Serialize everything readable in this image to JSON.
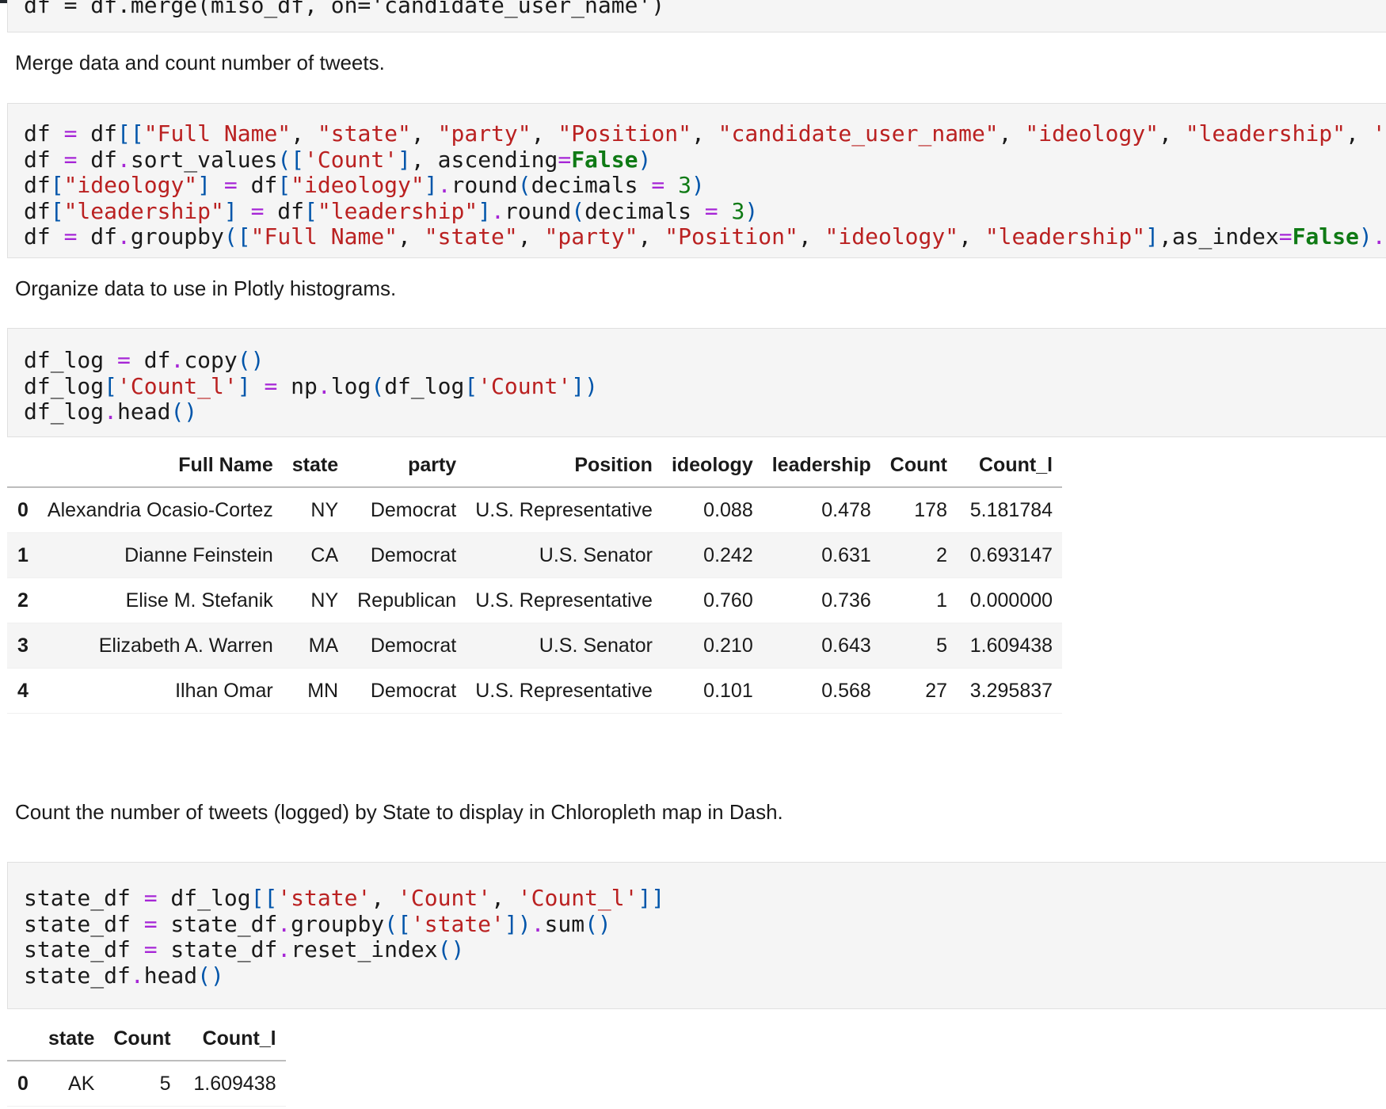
{
  "cells": {
    "top_code_fragment": "df = df.merge(miso_df, on='candidate_user_name')",
    "md1": "Merge data and count number of tweets.",
    "md2": "Organize data to use in Plotly histograms.",
    "md3": "Count the number of tweets (logged) by State to display in Chloropleth map in Dash."
  },
  "table1": {
    "columns": [
      "Full Name",
      "state",
      "party",
      "Position",
      "ideology",
      "leadership",
      "Count",
      "Count_l"
    ],
    "rows": [
      {
        "index": "0",
        "full_name": "Alexandria Ocasio-Cortez",
        "state": "NY",
        "party": "Democrat",
        "position": "U.S. Representative",
        "ideology": "0.088",
        "leadership": "0.478",
        "count": "178",
        "count_l": "5.181784"
      },
      {
        "index": "1",
        "full_name": "Dianne Feinstein",
        "state": "CA",
        "party": "Democrat",
        "position": "U.S. Senator",
        "ideology": "0.242",
        "leadership": "0.631",
        "count": "2",
        "count_l": "0.693147"
      },
      {
        "index": "2",
        "full_name": "Elise M. Stefanik",
        "state": "NY",
        "party": "Republican",
        "position": "U.S. Representative",
        "ideology": "0.760",
        "leadership": "0.736",
        "count": "1",
        "count_l": "0.000000"
      },
      {
        "index": "3",
        "full_name": "Elizabeth A. Warren",
        "state": "MA",
        "party": "Democrat",
        "position": "U.S. Senator",
        "ideology": "0.210",
        "leadership": "0.643",
        "count": "5",
        "count_l": "1.609438"
      },
      {
        "index": "4",
        "full_name": "Ilhan Omar",
        "state": "MN",
        "party": "Democrat",
        "position": "U.S. Representative",
        "ideology": "0.101",
        "leadership": "0.568",
        "count": "27",
        "count_l": "3.295837"
      }
    ]
  },
  "table2": {
    "columns": [
      "state",
      "Count",
      "Count_l"
    ],
    "rows": [
      {
        "index": "0",
        "state": "AK",
        "count": "5",
        "count_l": "1.609438"
      }
    ]
  },
  "colors": {
    "operator": "#a626d6",
    "string": "#ba2121",
    "keyword": "#0f7a15",
    "bracket": "#0055aa",
    "cell_bg": "#f5f5f5"
  }
}
